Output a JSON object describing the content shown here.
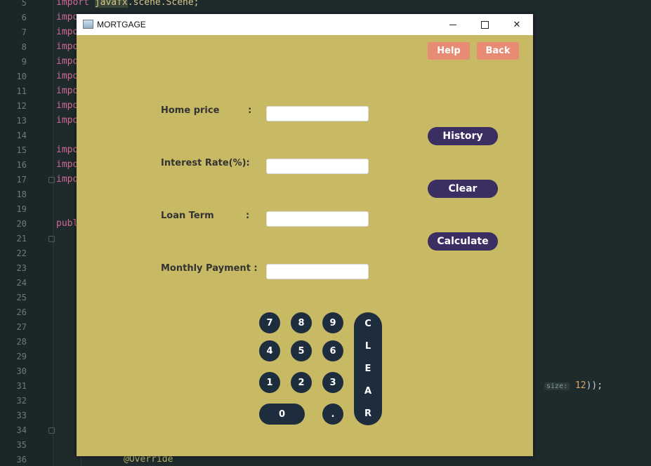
{
  "ide": {
    "line_numbers": [
      "5",
      "6",
      "7",
      "8",
      "9",
      "10",
      "11",
      "12",
      "13",
      "14",
      "15",
      "16",
      "17",
      "18",
      "19",
      "20",
      "21",
      "22",
      "23",
      "24",
      "25",
      "26",
      "27",
      "28",
      "29",
      "30",
      "31",
      "32",
      "33",
      "34",
      "35",
      "36"
    ],
    "line5_keyword": "import",
    "line5_type": "javafx",
    "line5_rest": ".scene.Scene;",
    "import_fragment": "impo",
    "public_fragment": "publ",
    "param_hint": "size:",
    "line31_tail_num": "12",
    "line31_tail_rest": "));",
    "override": "@Override"
  },
  "window": {
    "title": "MORTGAGE",
    "minimize_glyph": "",
    "close_glyph": "✕"
  },
  "top_buttons": {
    "help": "Help",
    "back": "Back"
  },
  "form": {
    "home_price_label": "Home price         :",
    "interest_label": "Interest Rate(%):",
    "loan_term_label": "Loan Term          :",
    "monthly_label": "Monthly Payment :",
    "home_price_value": "",
    "interest_value": "",
    "loan_term_value": "",
    "monthly_value": ""
  },
  "actions": {
    "history": "History",
    "clear": "Clear",
    "calculate": "Calculate"
  },
  "keypad": {
    "k7": "7",
    "k8": "8",
    "k9": "9",
    "k4": "4",
    "k5": "5",
    "k6": "6",
    "k1": "1",
    "k2": "2",
    "k3": "3",
    "k0": "0",
    "dot": ".",
    "clear_letters": [
      "C",
      "L",
      "E",
      "A",
      "R"
    ]
  },
  "colors": {
    "window_bg": "#c8b964",
    "accent_red": "#e78b74",
    "action_navy": "#3b2e63",
    "key_dark": "#1e2d3e"
  }
}
